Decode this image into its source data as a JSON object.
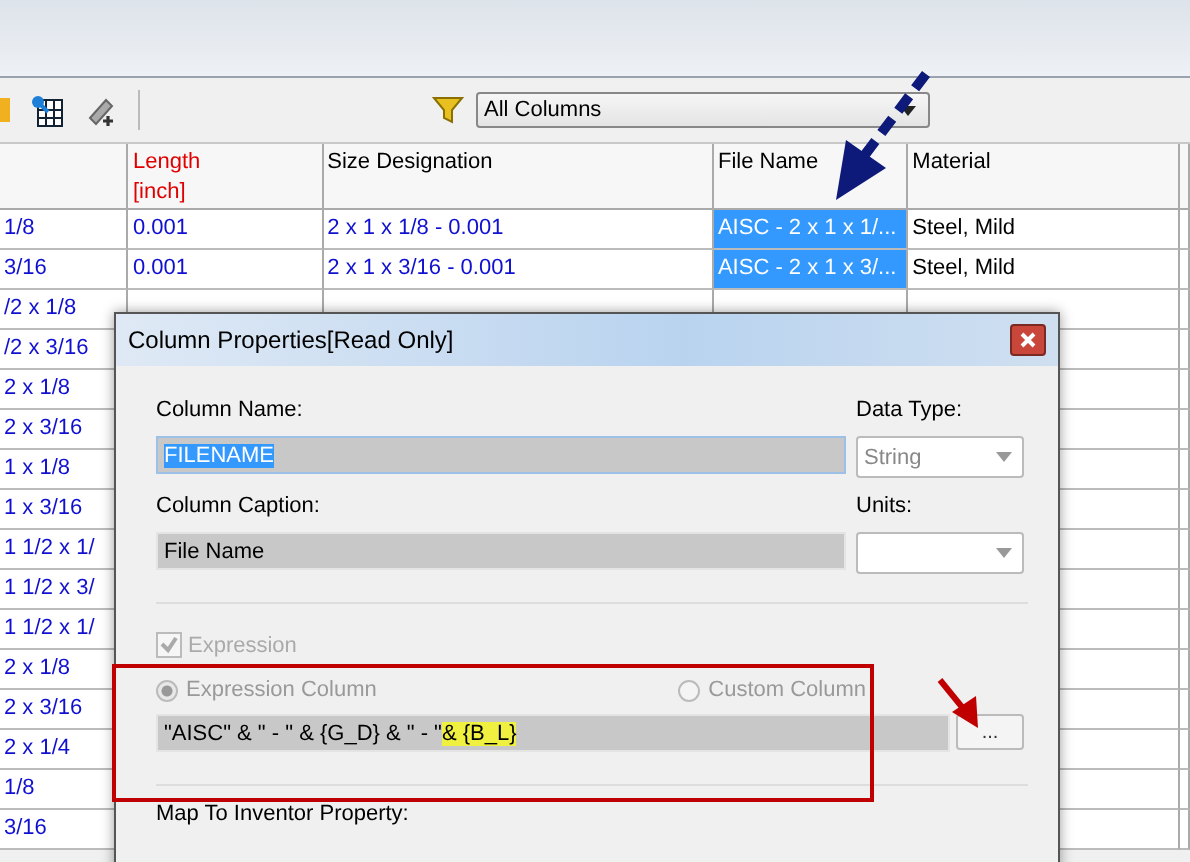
{
  "toolbar": {
    "column_filter": "All Columns"
  },
  "table": {
    "columns": [
      {
        "selected": false
      },
      {
        "label": "Length",
        "unit": "[inch]",
        "key_param": true,
        "selected": false
      },
      {
        "label": "Size Designation",
        "key_param": false,
        "selected": false
      },
      {
        "label": "File Name",
        "key_param": false,
        "selected": true
      },
      {
        "label": "Material",
        "key_param": false,
        "selected": false
      }
    ],
    "rows": [
      {
        "cells": [
          "1/8",
          "0.001",
          "2 x 1 x 1/8 - 0.001",
          "AISC - 2 x 1 x 1/...",
          "Steel, Mild"
        ]
      },
      {
        "cells": [
          "3/16",
          "0.001",
          "2 x 1 x 3/16 - 0.001",
          "AISC - 2 x 1 x 3/...",
          "Steel, Mild"
        ]
      },
      {
        "cells": [
          "/2 x 1/8"
        ]
      },
      {
        "cells": [
          "/2 x 3/16"
        ]
      },
      {
        "cells": [
          "2 x 1/8"
        ]
      },
      {
        "cells": [
          "2 x 3/16"
        ]
      },
      {
        "cells": [
          "1 x 1/8"
        ]
      },
      {
        "cells": [
          "1 x 3/16"
        ]
      },
      {
        "cells": [
          "1 1/2 x 1/"
        ]
      },
      {
        "cells": [
          "1 1/2 x 3/"
        ]
      },
      {
        "cells": [
          "1 1/2 x 1/"
        ]
      },
      {
        "cells": [
          "2 x 1/8"
        ]
      },
      {
        "cells": [
          "2 x 3/16"
        ]
      },
      {
        "cells": [
          "2 x 1/4"
        ]
      },
      {
        "cells": [
          "1/8"
        ]
      },
      {
        "cells": [
          "3/16"
        ]
      }
    ]
  },
  "dialog": {
    "title": "Column Properties[Read Only]",
    "column_name_label": "Column Name:",
    "column_name": "FILENAME",
    "column_name_selected": true,
    "data_type_label": "Data Type:",
    "data_type": "String",
    "caption_label": "Column Caption:",
    "caption": "File Name",
    "units_label": "Units:",
    "expression_checkbox": {
      "label": "Expression",
      "checked": true,
      "disabled": true
    },
    "radios": [
      {
        "label": "Expression Column",
        "selected": true
      },
      {
        "label": "Custom Column",
        "selected": false
      }
    ],
    "expression_parts": [
      {
        "text": "\"AISC\" & \" - \" & {G_D} & \" - \" ",
        "highlighted": false
      },
      {
        "text": "& {B_L}",
        "highlighted": true
      }
    ],
    "browse_button": "...",
    "map_label": "Map To Inventor Property:"
  }
}
